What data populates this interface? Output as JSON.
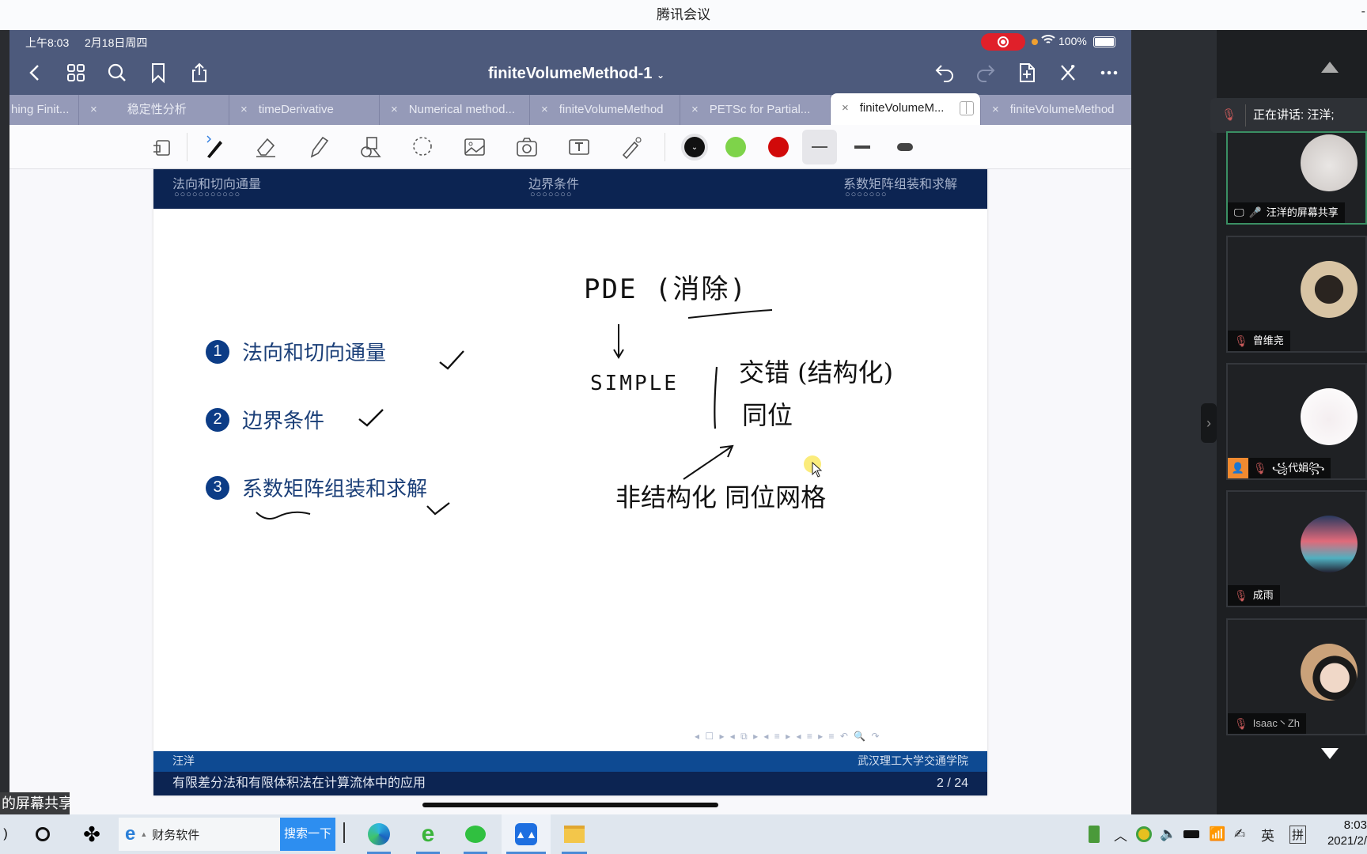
{
  "window": {
    "title": "腾讯会议"
  },
  "ipad": {
    "status": {
      "time": "上午8:03",
      "date": "2月18日周四",
      "battery": "100%"
    },
    "doc_title": "finiteVolumeMethod-1",
    "tabs": [
      {
        "label": "hing Finit...",
        "active": false
      },
      {
        "label": "稳定性分析",
        "active": false
      },
      {
        "label": "timeDerivative",
        "active": false
      },
      {
        "label": "Numerical method...",
        "active": false
      },
      {
        "label": "finiteVolumeMethod",
        "active": false
      },
      {
        "label": "PETSc for Partial...",
        "active": false
      },
      {
        "label": "finiteVolumeM...",
        "active": true
      },
      {
        "label": "finiteVolumeMethod",
        "active": false
      }
    ],
    "colors": {
      "black": "#111111",
      "green": "#7ed34a",
      "red": "#d10a0a"
    }
  },
  "slide": {
    "header_sections": [
      {
        "label": "法向和切向通量",
        "dots": "○○○○○○○○○○○"
      },
      {
        "label": "边界条件",
        "dots": "○○○○○○○"
      },
      {
        "label": "系数矩阵组装和求解",
        "dots": "○○○○○○○"
      }
    ],
    "items": [
      {
        "num": "1",
        "text": "法向和切向通量"
      },
      {
        "num": "2",
        "text": "边界条件"
      },
      {
        "num": "3",
        "text": "系数矩阵组装和求解"
      }
    ],
    "handwriting": {
      "line1": "PDE (消除)",
      "line2": "SIMPLE",
      "branch1": "交错 (结构化)",
      "branch2": "同位",
      "line3": "非结构化 同位网格"
    },
    "footer": {
      "author": "汪洋",
      "institute": "武汉理工大学交通学院",
      "title": "有限差分法和有限体积法在计算流体中的应用",
      "page": "2 / 24"
    }
  },
  "meeting": {
    "speaking": "正在讲话: 汪洋;",
    "participants": [
      {
        "name": "汪洋的屏幕共享",
        "sharing": true
      },
      {
        "name": "曾维尧",
        "sharing": false
      },
      {
        "name": "꧁代娟꧂",
        "sharing": false
      },
      {
        "name": "成雨",
        "sharing": false
      },
      {
        "name": "Isaac丶Zh",
        "sharing": false
      }
    ],
    "shared_label": "的屏幕共享"
  },
  "taskbar": {
    "search_placeholder": "财务软件",
    "search_button": "搜索一下",
    "ime_lang": "英",
    "ime_mode": "拼",
    "clock_time": "8:03",
    "clock_date": "2021/2/"
  }
}
